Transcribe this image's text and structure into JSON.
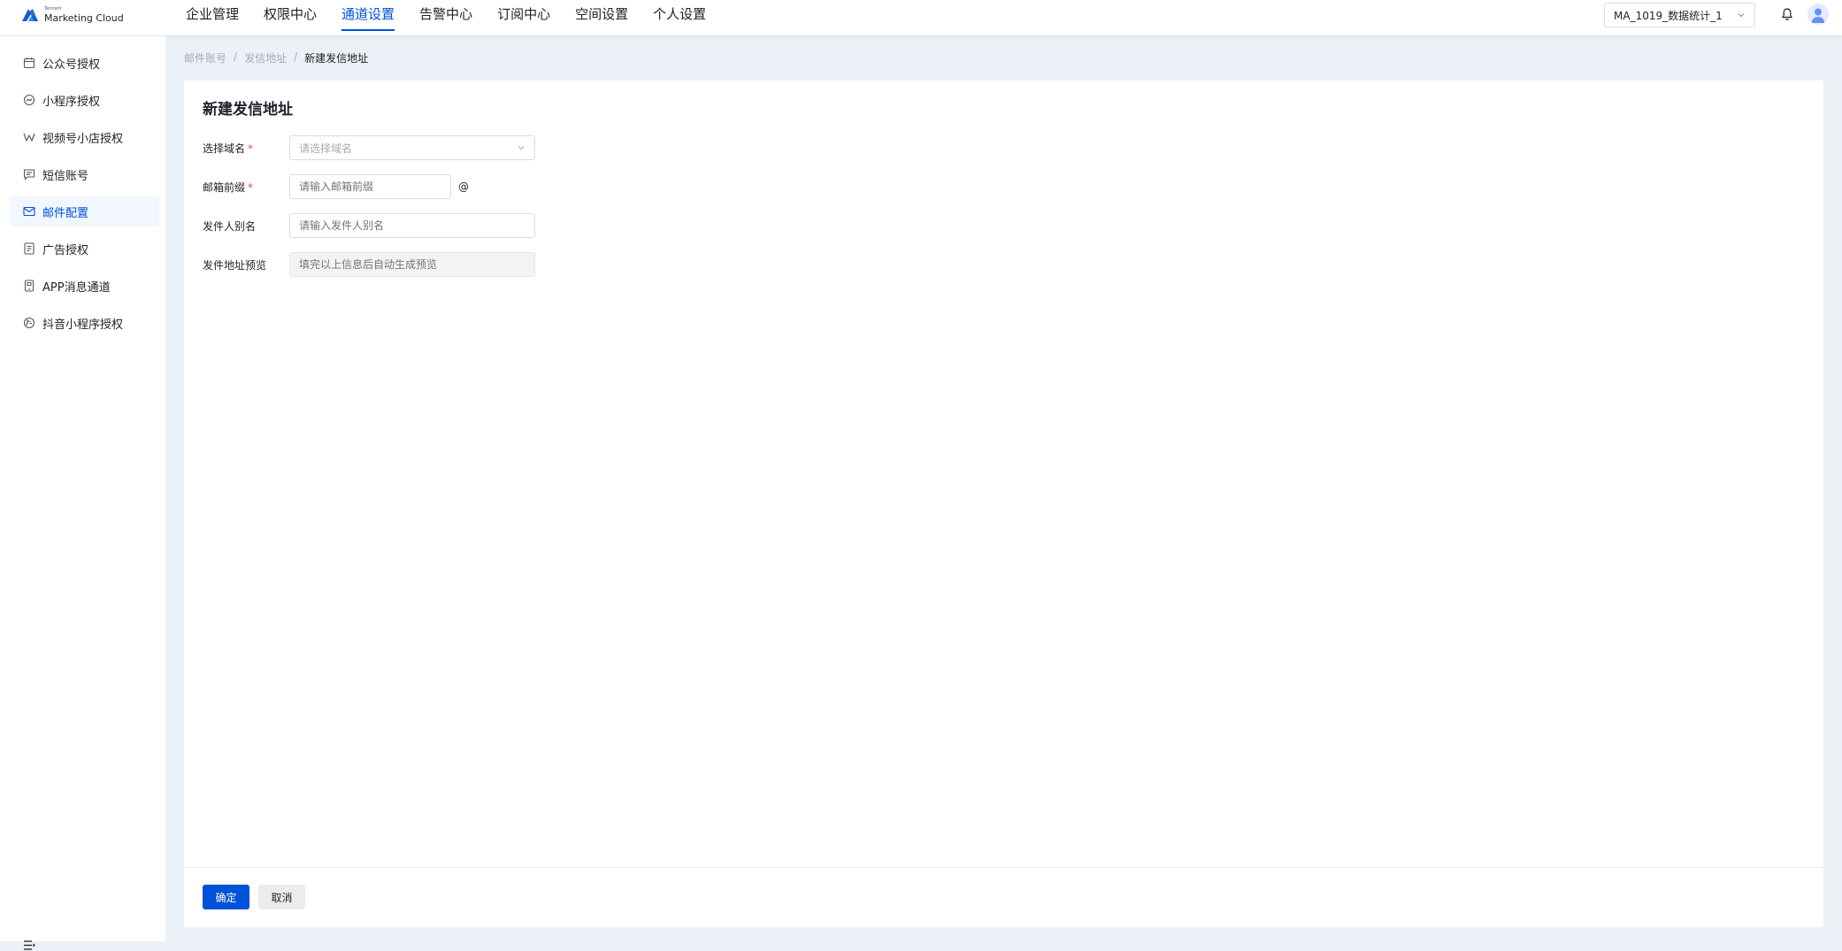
{
  "brand": {
    "small": "Tencent",
    "main": "Marketing Cloud"
  },
  "topnav": {
    "items": [
      {
        "label": "企业管理"
      },
      {
        "label": "权限中心"
      },
      {
        "label": "通道设置",
        "active": true
      },
      {
        "label": "告警中心"
      },
      {
        "label": "订阅中心"
      },
      {
        "label": "空间设置"
      },
      {
        "label": "个人设置"
      }
    ]
  },
  "space_select": {
    "value": "MA_1019_数据统计_1"
  },
  "sidebar": {
    "items": [
      {
        "label": "公众号授权",
        "icon": "calendar-icon"
      },
      {
        "label": "小程序授权",
        "icon": "mini-program-icon"
      },
      {
        "label": "视频号小店授权",
        "icon": "video-channel-icon"
      },
      {
        "label": "短信账号",
        "icon": "sms-icon"
      },
      {
        "label": "邮件配置",
        "icon": "mail-icon",
        "active": true
      },
      {
        "label": "广告授权",
        "icon": "document-icon"
      },
      {
        "label": "APP消息通道",
        "icon": "app-message-icon"
      },
      {
        "label": "抖音小程序授权",
        "icon": "douyin-icon"
      }
    ]
  },
  "breadcrumb": {
    "items": [
      "邮件账号",
      "发信地址",
      "新建发信地址"
    ],
    "separator": "/"
  },
  "form": {
    "title": "新建发信地址",
    "domain": {
      "label": "选择域名",
      "placeholder": "请选择域名",
      "required": "*"
    },
    "prefix": {
      "label": "邮箱前缀",
      "placeholder": "请输入邮箱前缀",
      "required": "*",
      "suffix": "@"
    },
    "alias": {
      "label": "发件人别名",
      "placeholder": "请输入发件人别名"
    },
    "preview": {
      "label": "发件地址预览",
      "placeholder": "填完以上信息后自动生成预览"
    }
  },
  "actions": {
    "ok": "确定",
    "cancel": "取消"
  },
  "colors": {
    "primary": "#0052d9",
    "required": "#e34d59",
    "active_bg": "#f2f6ff",
    "page_bg": "#ecf0f7"
  }
}
